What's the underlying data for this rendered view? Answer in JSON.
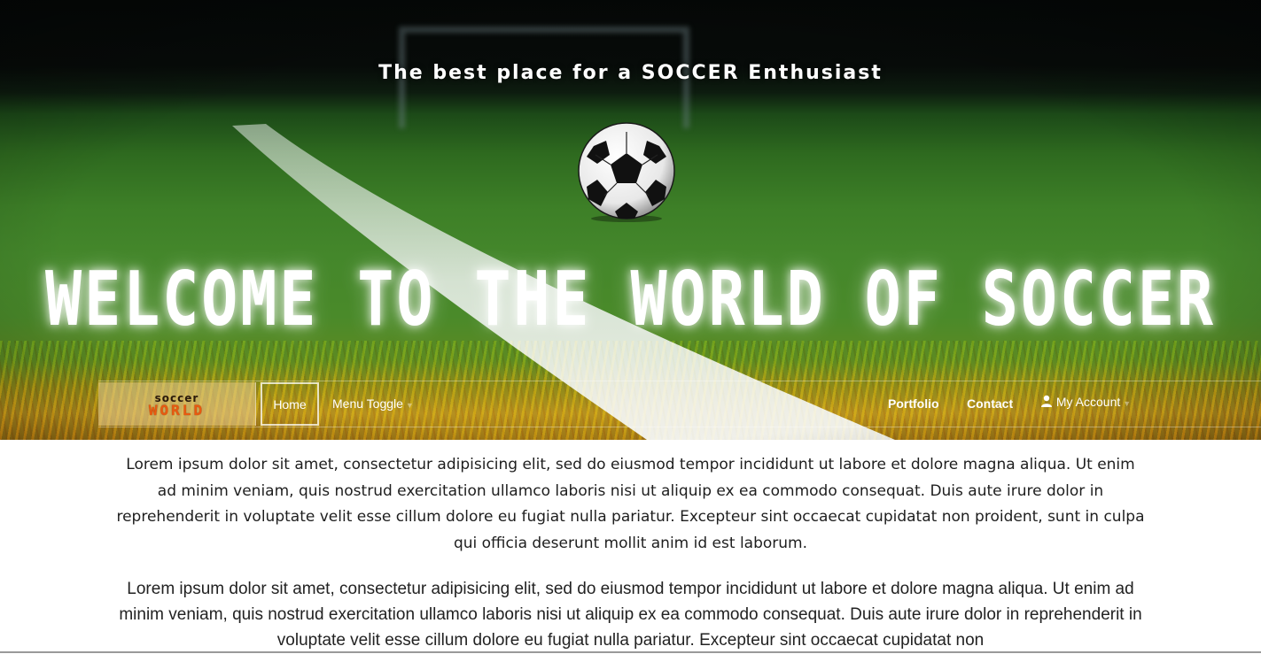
{
  "hero": {
    "tagline": "The best place for a SOCCER Enthusiast",
    "welcome": "WELCOME TO THE WORLD OF SOCCER"
  },
  "navbar": {
    "logo_top": "soccer",
    "logo_bottom": "WORLD",
    "items": [
      {
        "label": "Home"
      },
      {
        "label": "Menu Toggle"
      },
      {
        "label": "Portfolio"
      },
      {
        "label": "Contact"
      },
      {
        "label": "My Account"
      }
    ]
  },
  "content": {
    "paragraph1": "Lorem ipsum dolor sit amet, consectetur adipisicing elit, sed do eiusmod tempor incididunt ut labore et dolore magna aliqua. Ut enim ad minim veniam, quis nostrud exercitation ullamco laboris nisi ut aliquip ex ea commodo consequat. Duis aute irure dolor in reprehenderit in voluptate velit esse cillum dolore eu fugiat nulla pariatur. Excepteur sint occaecat cupidatat non proident, sunt in culpa qui officia deserunt mollit anim id est laborum.",
    "paragraph2": "Lorem ipsum dolor sit amet, consectetur adipisicing elit, sed do eiusmod tempor incididunt ut labore et dolore magna aliqua. Ut enim ad minim veniam, quis nostrud exercitation ullamco laboris nisi ut aliquip ex ea commodo consequat. Duis aute irure dolor in reprehenderit in voluptate velit esse cillum dolore eu fugiat nulla pariatur. Excepteur sint occaecat cupidatat non"
  },
  "colors": {
    "logo_accent": "#e85a10",
    "text": "#1e1e1e",
    "nav_text": "#ffffff"
  },
  "icons": {
    "ball": "soccer-ball-icon",
    "account": "user-icon"
  }
}
